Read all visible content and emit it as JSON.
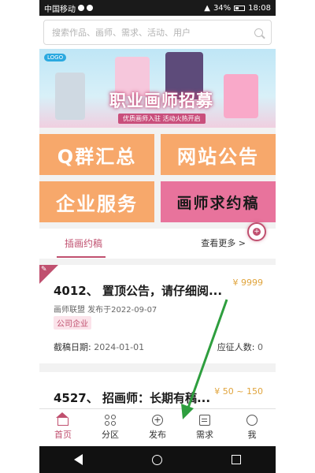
{
  "status_bar": {
    "carrier": "中国移动",
    "battery": "34%",
    "time": "18:08"
  },
  "search": {
    "placeholder": "搜索作品、画师、需求、活动、用户"
  },
  "banner": {
    "title": "职业画师招募",
    "subtitle": "优质画师入驻 活动火热开启"
  },
  "quick_tiles": [
    {
      "label": "Q群汇总"
    },
    {
      "label": "网站公告"
    },
    {
      "label": "企业服务"
    },
    {
      "label": "画师求约稿"
    }
  ],
  "section_tabs": {
    "active_tab": "插画约稿",
    "more_label": "查看更多 >"
  },
  "posts": [
    {
      "title": "4012、 置顶公告，请仔细阅...",
      "price": "¥ 9999",
      "meta": "画师联盟 发布于2022-09-07",
      "tag": "公司企业",
      "deadline_label": "截稿日期:",
      "deadline_value": "2024-01-01",
      "applicants_label": "应征人数:",
      "applicants_value": "0"
    },
    {
      "title": "4527、 招画师：长期有稿...",
      "price": "¥ 50 ~ 150"
    }
  ],
  "bottom_tabs": [
    {
      "label": "首页",
      "icon": "home-icon",
      "active": true
    },
    {
      "label": "分区",
      "icon": "grid-icon",
      "active": false
    },
    {
      "label": "发布",
      "icon": "plus-circle-icon",
      "active": false
    },
    {
      "label": "需求",
      "icon": "document-icon",
      "active": false
    },
    {
      "label": "我",
      "icon": "user-icon",
      "active": false
    }
  ],
  "colors": {
    "accent": "#c0506f",
    "tile_orange": "#f7a86b",
    "tile_pink": "#e8739c",
    "price": "#e0a43c",
    "annotation_arrow": "#2e9e3e"
  }
}
